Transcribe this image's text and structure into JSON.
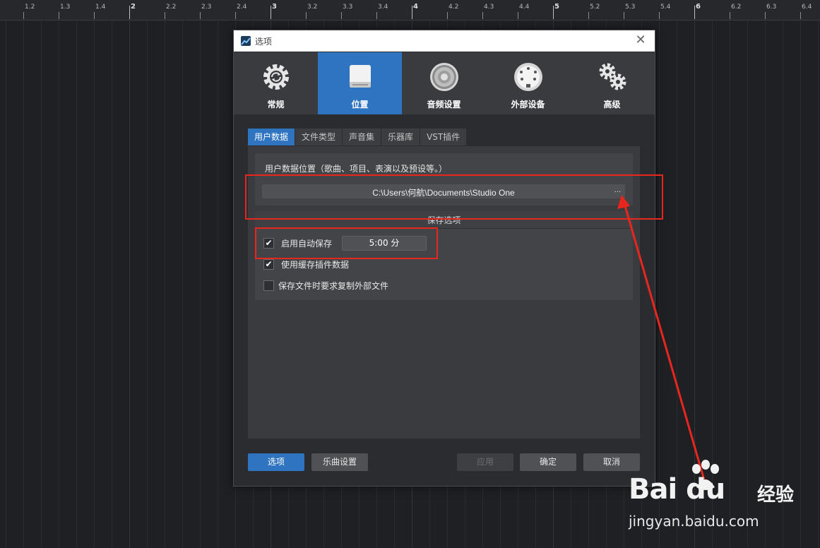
{
  "ruler": {
    "labels": [
      "1.2",
      "1.3",
      "1.4",
      "2",
      "2.2",
      "2.3",
      "2.4",
      "3",
      "3.2",
      "3.3",
      "3.4",
      "4",
      "4.2",
      "4.3",
      "4.4",
      "5",
      "5.2",
      "5.3",
      "5.4",
      "6",
      "6.2",
      "6.3",
      "6.4"
    ],
    "major": [
      "2",
      "3",
      "4",
      "5",
      "6"
    ]
  },
  "dialog": {
    "title": "选项",
    "close_glyph": "✕",
    "categories": [
      {
        "label": "常规",
        "icon": "sync-gear-icon"
      },
      {
        "label": "位置",
        "icon": "drive-icon",
        "active": true
      },
      {
        "label": "音频设置",
        "icon": "speaker-icon"
      },
      {
        "label": "外部设备",
        "icon": "midi-port-icon"
      },
      {
        "label": "高级",
        "icon": "gears-icon"
      }
    ],
    "subtabs": [
      "用户数据",
      "文件类型",
      "声音集",
      "乐器库",
      "VST插件"
    ],
    "active_subtab": "用户数据",
    "user_data": {
      "label": "用户数据位置（歌曲、项目、表演以及预设等。）",
      "path": "C:\\Users\\何航\\Documents\\Studio One",
      "browse": "..."
    },
    "save_options": {
      "header": "保存选项",
      "autosave_label": "启用自动保存",
      "autosave_checked": true,
      "autosave_value": "5:00 分",
      "cache_label": "使用缓存插件数据",
      "cache_checked": true,
      "copy_label": "保存文件时要求复制外部文件",
      "copy_checked": false
    },
    "buttons": {
      "options": "选项",
      "song_settings": "乐曲设置",
      "apply": "应用",
      "ok": "确定",
      "cancel": "取消"
    }
  },
  "watermark": {
    "brand": "Bai du",
    "sub": "经验",
    "url": "jingyan.baidu.com"
  },
  "colors": {
    "accent": "#2f74c0",
    "annotation": "#e8261e"
  }
}
